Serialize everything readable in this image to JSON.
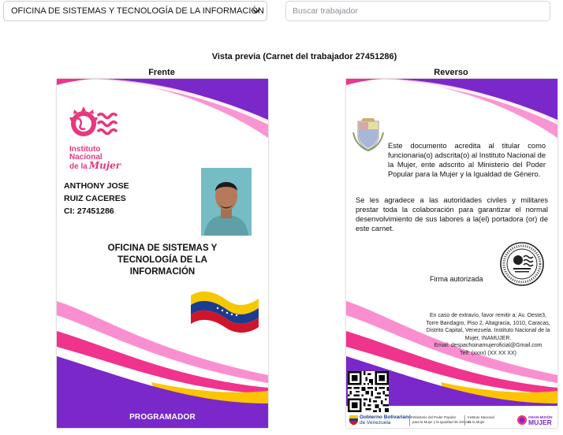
{
  "top": {
    "select_value": "OFICINA DE SISTEMAS Y TECNOLOGÍA DE LA INFORMACIÓN",
    "search_placeholder": "Buscar trabajador"
  },
  "preview": {
    "title": "Vista previa (Carnet del trabajador 27451286)",
    "front_label": "Frente",
    "back_label": "Reverso"
  },
  "front": {
    "logo_line1": "Instituto",
    "logo_line2": "Nacional",
    "logo_line3a": "de la",
    "logo_line3b": "Mujer",
    "first_names": "ANTHONY JOSE",
    "last_names": "RUIZ CACERES",
    "ci": "CI: 27451286",
    "office": "OFICINA DE SISTEMAS Y TECNOLOGÍA DE LA INFORMACIÓN",
    "role": "PROGRAMADOR"
  },
  "back": {
    "paragraph1": "Este documento acredita al titular como funcionaria(o) adscrita(o) al Instituto Nacional de la Mujer, ente adscrito al Ministerio del Poder Popular para la Mujer y la Igualdad de Género.",
    "paragraph2": "Se les agradece a las autoridades civiles y militares prestar toda la colaboración para garantizar el normal desenvolvimiento de sus labores a la(el) portadora (or) de este carnet.",
    "signature_label": "Firma autorizada",
    "contact_line1": "En caso de extravío, favor remitir a: Av. Oeste3,",
    "contact_line2": "Torre Bandagro, Piso 2, Altagracia, 1010, Caracas,",
    "contact_line3": "Distrito Capital, Venezuela. Instituto Nacional de la",
    "contact_line4": "Mujer, INAMUJER.",
    "contact_line5": "Email: despachoinamujeroficial@Gmail.com",
    "contact_line6": "Telf: (xxxx) (XX XX XX)",
    "footer_gob1": "Gobierno Bolivariano",
    "footer_gob2": "de Venezuela",
    "footer_min1": "Ministerio del Poder Popular",
    "footer_min2": "para la Mujer y la Igualdad de Género",
    "footer_inst1": "Instituto Nacional",
    "footer_inst2": "de la Mujer",
    "footer_logo_small": "GRAN MISIÓN",
    "footer_logo_big": "MUJER"
  },
  "colors": {
    "purple": "#7a28c9",
    "magenta": "#f0338c",
    "pink": "#f98fd0",
    "yellow": "#ffc400",
    "logo_pink": "#e8377f"
  }
}
